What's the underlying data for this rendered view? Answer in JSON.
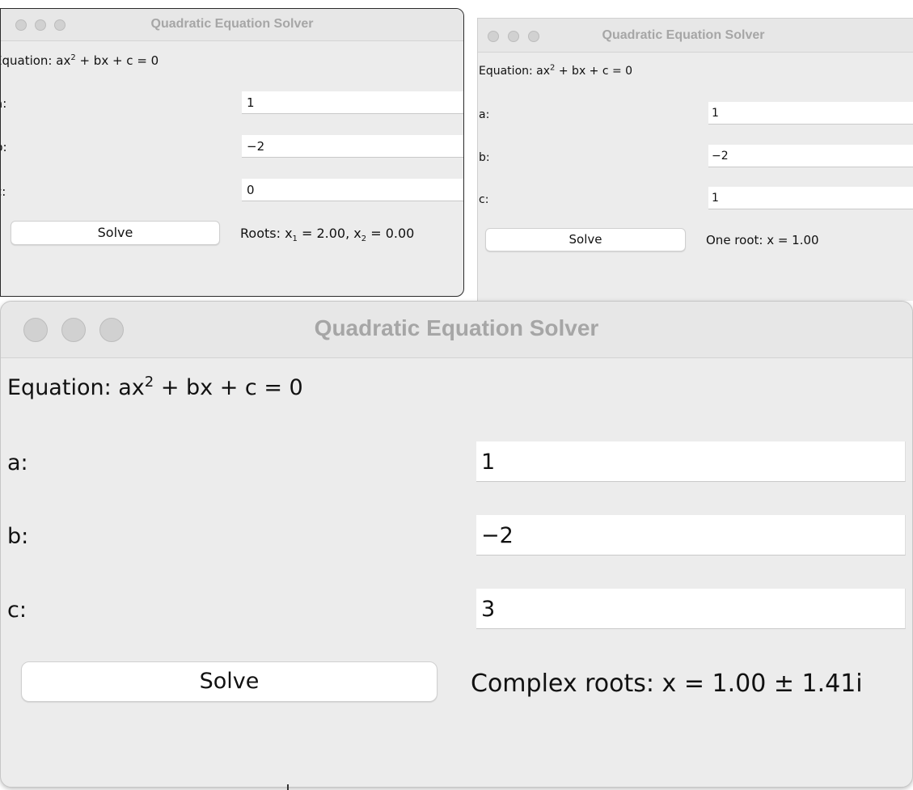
{
  "windows": [
    {
      "title": "Quadratic Equation Solver",
      "equation": {
        "prefix": "Equation: ax",
        "sup": "2",
        "suffix": " + bx + c = 0"
      },
      "labels": {
        "a": "a:",
        "b": "b:",
        "c": "c:"
      },
      "inputs": {
        "a": "1",
        "b": "−2",
        "c": "0"
      },
      "solve_label": "Solve",
      "result": {
        "p1": "Roots: x",
        "s1": "1",
        "p2": " = 2.00, x",
        "s2": "2",
        "p3": " = 0.00"
      }
    },
    {
      "title": "Quadratic Equation Solver",
      "equation": {
        "prefix": "Equation: ax",
        "sup": "2",
        "suffix": " + bx + c = 0"
      },
      "labels": {
        "a": "a:",
        "b": "b:",
        "c": "c:"
      },
      "inputs": {
        "a": "1",
        "b": "−2",
        "c": "1"
      },
      "solve_label": "Solve",
      "result": "One root: x = 1.00"
    },
    {
      "title": "Quadratic Equation Solver",
      "equation": {
        "prefix": "Equation: ax",
        "sup": "2",
        "suffix": " + bx + c = 0"
      },
      "labels": {
        "a": "a:",
        "b": "b:",
        "c": "c:"
      },
      "inputs": {
        "a": "1",
        "b": "−2",
        "c": "3"
      },
      "solve_label": "Solve",
      "result": "Complex roots: x = 1.00 ± 1.41i"
    }
  ],
  "colors": {
    "window_bg": "#ececec",
    "titlebar_bg": "#e7e7e7",
    "title_text": "#a6a6a6",
    "traffic_light_inactive": "#d1d1d1"
  }
}
